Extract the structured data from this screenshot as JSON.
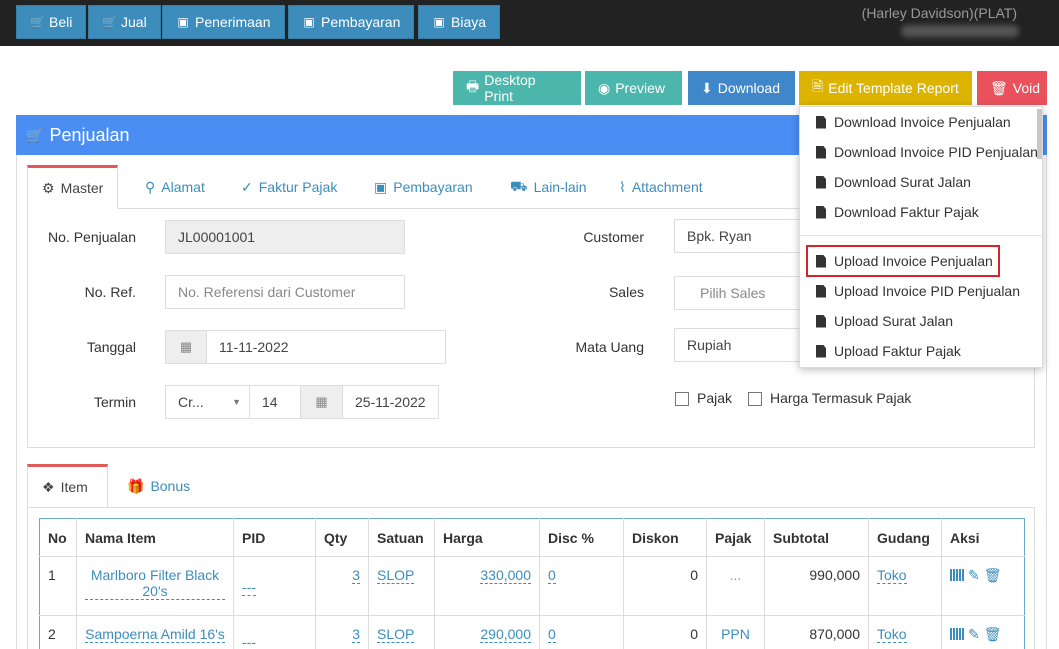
{
  "topbar": {
    "buttons": [
      {
        "label": "Beli",
        "icon": "cart-icon"
      },
      {
        "label": "Jual",
        "icon": "cart-icon"
      },
      {
        "label": "Penerimaan",
        "icon": "money-icon"
      },
      {
        "label": "Pembayaran",
        "icon": "money-icon"
      },
      {
        "label": "Biaya",
        "icon": "money-icon"
      }
    ],
    "company": "(Harley Davidson)(PLAT)"
  },
  "actions": {
    "desktop_print": "Desktop Print",
    "preview": "Preview",
    "download": "Download",
    "edit_template": "Edit Template Report",
    "void": "Void"
  },
  "dropdown": {
    "items": [
      "Download Invoice Penjualan",
      "Download Invoice PID Penjualan",
      "Download Surat Jalan",
      "Download Faktur Pajak",
      "Upload Invoice Penjualan",
      "Upload Invoice PID Penjualan",
      "Upload Surat Jalan",
      "Upload Faktur Pajak"
    ]
  },
  "panel": {
    "title": "Penjualan"
  },
  "tabs": [
    "Master",
    "Alamat",
    "Faktur Pajak",
    "Pembayaran",
    "Lain-lain",
    "Attachment"
  ],
  "form": {
    "no_penjualan_label": "No. Penjualan",
    "no_penjualan_value": "JL00001001",
    "no_ref_label": "No. Ref.",
    "no_ref_placeholder": "No. Referensi dari Customer",
    "tanggal_label": "Tanggal",
    "tanggal_value": "11-11-2022",
    "termin_label": "Termin",
    "termin_type": "Cr...",
    "termin_days": "14",
    "termin_date": "25-11-2022",
    "customer_label": "Customer",
    "customer_value": "Bpk. Ryan",
    "sales_label": "Sales",
    "sales_placeholder": "Pilih Sales",
    "mata_uang_label": "Mata Uang",
    "mata_uang_value": "Rupiah",
    "pajak_label": "Pajak",
    "harga_termasuk_label": "Harga Termasuk Pajak"
  },
  "item_tabs": [
    "Item",
    "Bonus"
  ],
  "table": {
    "headers": [
      "No",
      "Nama Item",
      "PID",
      "Qty",
      "Satuan",
      "Harga",
      "Disc %",
      "Diskon",
      "Pajak",
      "Subtotal",
      "Gudang",
      "Aksi"
    ],
    "rows": [
      {
        "no": "1",
        "nama": "Marlboro Filter Black 20's",
        "pid": "---",
        "qty": "3",
        "satuan": "SLOP",
        "harga": "330,000",
        "disc": "0",
        "diskon": "0",
        "pajak": "...",
        "subtotal": "990,000",
        "gudang": "Toko"
      },
      {
        "no": "2",
        "nama": "Sampoerna Amild 16's",
        "pid": "---",
        "qty": "3",
        "satuan": "SLOP",
        "harga": "290,000",
        "disc": "0",
        "diskon": "0",
        "pajak": "PPN",
        "subtotal": "870,000",
        "gudang": "Toko"
      }
    ]
  }
}
